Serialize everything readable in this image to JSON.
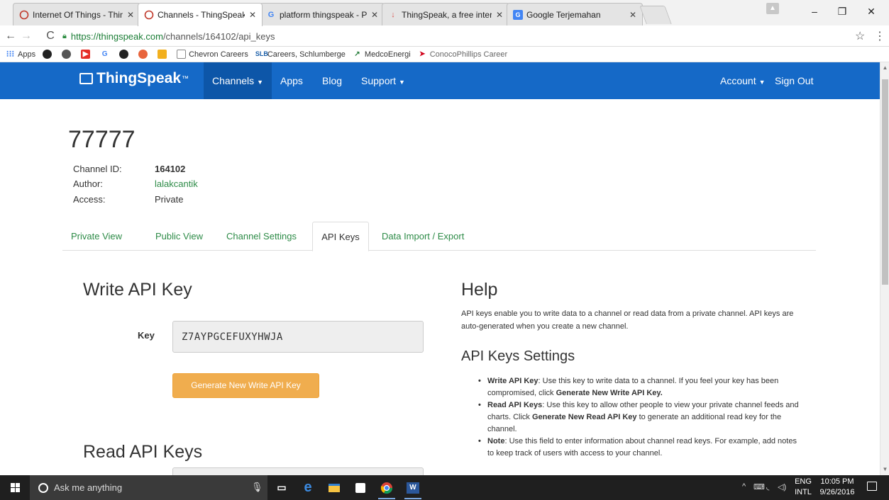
{
  "browser": {
    "tabs": [
      {
        "title": "Internet Of Things - Thin",
        "icon": "ring-icon",
        "color": "#c0392b"
      },
      {
        "title": "Channels - ThingSpeak",
        "icon": "ring-icon",
        "color": "#c0392b"
      },
      {
        "title": "platform thingspeak - Pe",
        "icon": "google-icon",
        "color": "#4285f4"
      },
      {
        "title": "ThingSpeak, a free interr",
        "icon": "arrow-down-icon",
        "color": "#d9534f"
      },
      {
        "title": "Google Terjemahan",
        "icon": "translate-icon",
        "color": "#4285f4"
      }
    ],
    "url_host": "https://thingspeak.com",
    "url_path": "/channels/164102/api_keys",
    "bookmarks": [
      {
        "label": "Apps"
      },
      {
        "label": ""
      },
      {
        "label": ""
      },
      {
        "label": ""
      },
      {
        "label": ""
      },
      {
        "label": ""
      },
      {
        "label": ""
      },
      {
        "label": ""
      },
      {
        "label": "Chevron Careers"
      },
      {
        "label": "Careers, Schlumberge"
      },
      {
        "label": "MedcoEnergi"
      },
      {
        "label": "ConocoPhillips Career"
      }
    ]
  },
  "navbar": {
    "brand": "ThingSpeak",
    "brand_tm": "™",
    "channels": "Channels",
    "apps": "Apps",
    "blog": "Blog",
    "support": "Support",
    "account": "Account",
    "sign_out": "Sign Out",
    "bg_color": "#1569c7"
  },
  "channel": {
    "name": "77777",
    "id_label": "Channel ID:",
    "id_value": "164102",
    "author_label": "Author:",
    "author_value": "lalakcantik",
    "access_label": "Access:",
    "access_value": "Private"
  },
  "tabs": [
    "Private View",
    "Public View",
    "Channel Settings",
    "API Keys",
    "Data Import / Export"
  ],
  "write": {
    "heading": "Write API Key",
    "key_label": "Key",
    "key_value": "Z7AYPGCEFUXYHWJA",
    "button": "Generate New Write API Key",
    "button_color": "#f0ad4e"
  },
  "read": {
    "heading": "Read API Keys"
  },
  "help": {
    "heading": "Help",
    "text": "API keys enable you to write data to a channel or read data from a private channel. API keys are auto-generated when you create a new channel.",
    "settings_heading": "API Keys Settings",
    "items": [
      {
        "b1": "Write API Key",
        "t1": ": Use this key to write data to a channel. If you feel your key has been compromised, click ",
        "b2": "Generate New Write API Key.",
        "t2": ""
      },
      {
        "b1": "Read API Keys",
        "t1": ": Use this key to allow other people to view your private channel feeds and charts. Click ",
        "b2": "Generate New Read API Key",
        "t2": " to generate an additional read key for the channel."
      },
      {
        "b1": "Note",
        "t1": ": Use this field to enter information about channel read keys. For example, add notes to keep track of users with access to your channel.",
        "b2": "",
        "t2": ""
      }
    ]
  },
  "taskbar": {
    "search_placeholder": "Ask me anything",
    "lang_line1": "ENG",
    "lang_line2": "INTL",
    "time": "10:05 PM",
    "date": "9/26/2016"
  }
}
